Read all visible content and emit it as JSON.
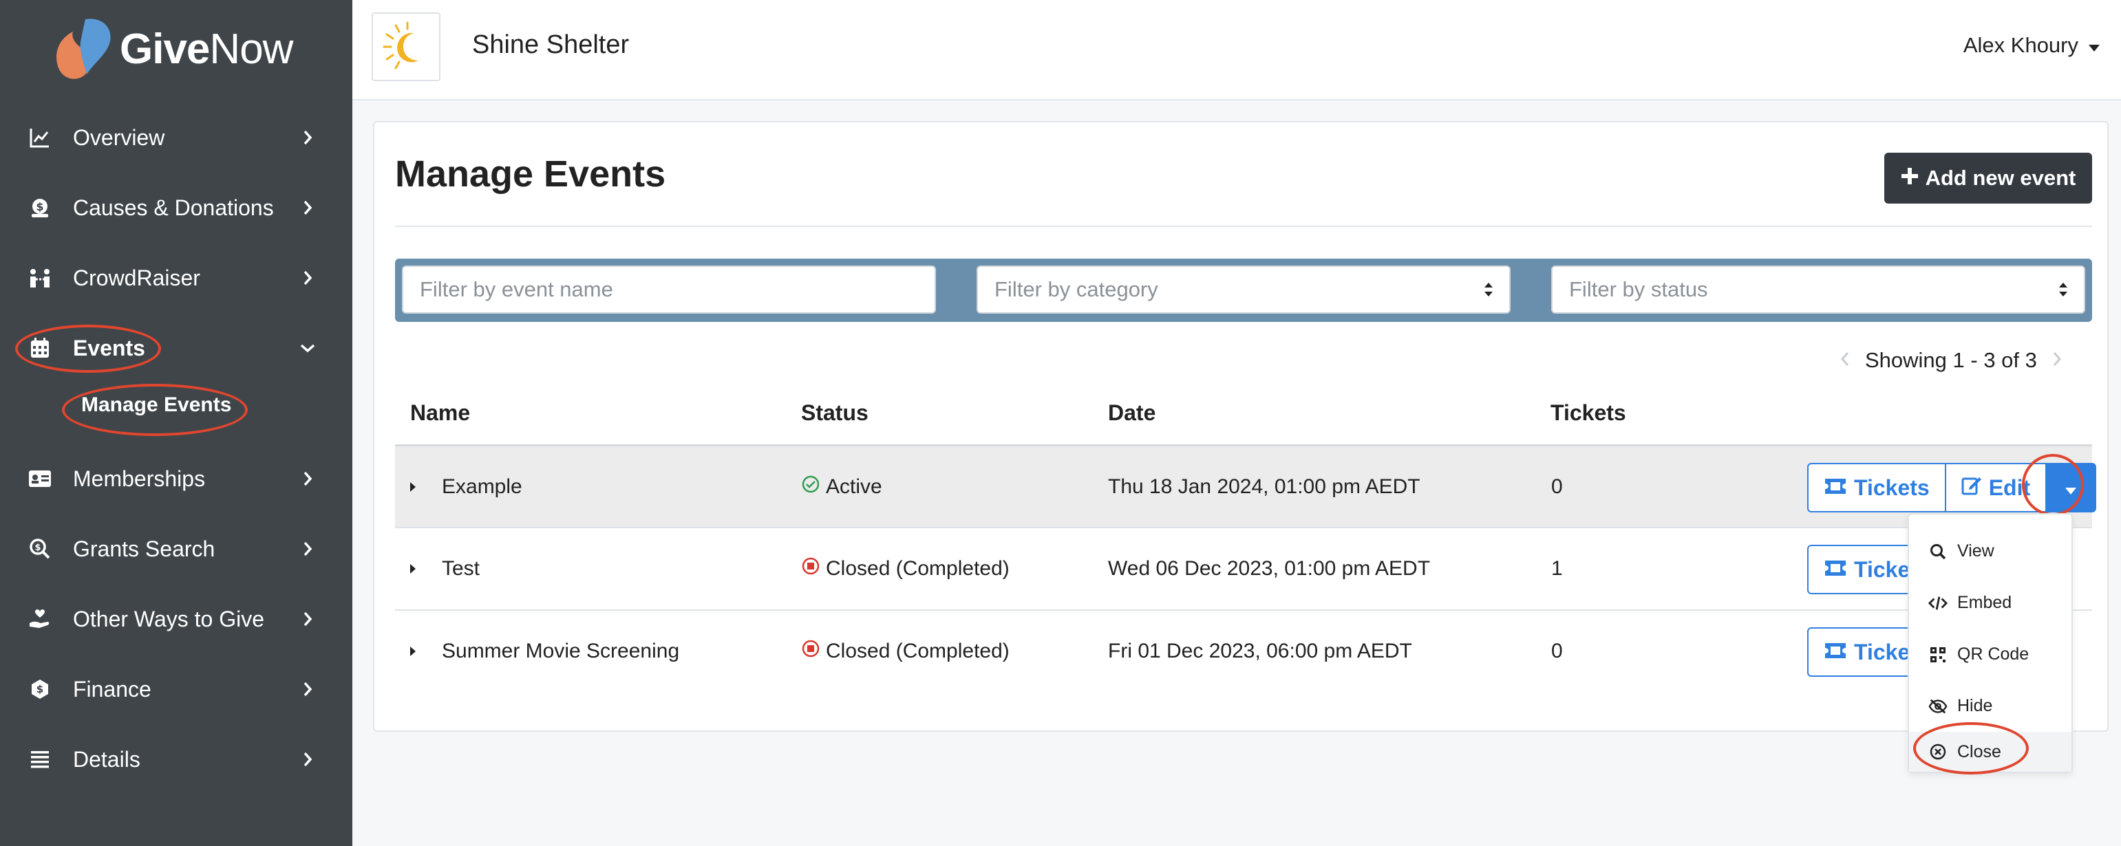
{
  "brand": {
    "logo_bold": "Give",
    "logo_light": "Now"
  },
  "sidebar": {
    "items": [
      {
        "label": "Overview",
        "icon": "chart-line-icon"
      },
      {
        "label": "Causes & Donations",
        "icon": "money-bag-icon"
      },
      {
        "label": "CrowdRaiser",
        "icon": "people-icon"
      },
      {
        "label": "Events",
        "icon": "calendar-icon"
      },
      {
        "label": "Memberships",
        "icon": "id-card-icon"
      },
      {
        "label": "Grants Search",
        "icon": "search-dollar-icon"
      },
      {
        "label": "Other Ways to Give",
        "icon": "hand-heart-icon"
      },
      {
        "label": "Finance",
        "icon": "coin-icon"
      },
      {
        "label": "Details",
        "icon": "list-icon"
      }
    ],
    "sub_item": "Manage Events"
  },
  "header": {
    "org_name": "Shine Shelter",
    "user_name": "Alex Khoury"
  },
  "page": {
    "title": "Manage Events",
    "add_button": "Add new event",
    "filters": {
      "name_placeholder": "Filter by event name",
      "category_placeholder": "Filter by category",
      "status_placeholder": "Filter by status"
    },
    "paging": "Showing 1 - 3 of 3"
  },
  "table": {
    "headers": [
      "Name",
      "Status",
      "Date",
      "Tickets"
    ],
    "rows": [
      {
        "name": "Example",
        "status": "Active",
        "date": "Thu 18 Jan 2024, 01:00 pm AEDT",
        "tickets": "0"
      },
      {
        "name": "Test",
        "status": "Closed (Completed)",
        "date": "Wed 06 Dec 2023, 01:00 pm AEDT",
        "tickets": "1"
      },
      {
        "name": "Summer Movie Screening",
        "status": "Closed (Completed)",
        "date": "Fri 01 Dec 2023, 06:00 pm AEDT",
        "tickets": "0"
      }
    ],
    "actions": {
      "tickets": "Tickets",
      "tickets_clipped": "Ticket",
      "edit": "Edit"
    }
  },
  "dropdown": {
    "items": [
      {
        "label": "View",
        "icon": "magnifier-icon"
      },
      {
        "label": "Embed",
        "icon": "code-icon"
      },
      {
        "label": "QR Code",
        "icon": "qrcode-icon"
      },
      {
        "label": "Hide",
        "icon": "eye-slash-icon"
      },
      {
        "label": "Close",
        "icon": "circle-x-icon"
      }
    ]
  },
  "colors": {
    "sidebar_bg": "#3f4549",
    "primary": "#2f7fe0",
    "active_green": "#2e9e4f",
    "closed_red": "#d9382f",
    "filter_bar": "#6a8fac",
    "annotation": "#e0462f"
  }
}
